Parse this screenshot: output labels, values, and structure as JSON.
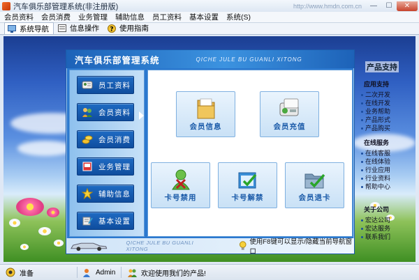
{
  "window": {
    "title": "汽车俱乐部管理系统(非注册版)",
    "url_hint": "http://www.hmdn.com.cn"
  },
  "menu": [
    "会员资料",
    "会员消费",
    "业务管理",
    "辅助信息",
    "员工资料",
    "基本设置",
    "系统(S)"
  ],
  "tabs": [
    {
      "label": "系统导航",
      "icon": "monitor-icon",
      "active": true
    },
    {
      "label": "信息操作",
      "icon": "form-icon",
      "active": false
    },
    {
      "label": "使用指南",
      "icon": "help-icon",
      "active": false
    }
  ],
  "dialog": {
    "title": "汽车俱乐部管理系统",
    "title_en": "QICHE JULE BU GUANLI XITONG",
    "sidebar": [
      {
        "label": "员工资料",
        "icon": "id-card-icon"
      },
      {
        "label": "会员资料",
        "icon": "members-icon"
      },
      {
        "label": "会员消费",
        "icon": "coins-icon"
      },
      {
        "label": "业务管理",
        "icon": "business-icon"
      },
      {
        "label": "辅助信息",
        "icon": "star-icon"
      },
      {
        "label": "基本设置",
        "icon": "settings-icon"
      }
    ],
    "cards": [
      {
        "label": "会员信息",
        "icon": "folder-icon"
      },
      {
        "label": "会员充值",
        "icon": "card-reader-icon"
      },
      {
        "label": "卡号禁用",
        "icon": "user-disable-icon"
      },
      {
        "label": "卡号解禁",
        "icon": "calendar-check-icon"
      },
      {
        "label": "会员退卡",
        "icon": "folder-check-icon"
      }
    ],
    "footer_en": "QICHE JULE BU GUANLI XITONG",
    "footer_tip": "使用F8键可以显示/隐藏当前导航窗口"
  },
  "support": {
    "heading": "产品支持",
    "sections": [
      {
        "title": "应用支持",
        "items": [
          "二次开发",
          "在线开发",
          "业务帮助",
          "产品形式",
          "产品购买"
        ]
      },
      {
        "title": "在线服务",
        "items": [
          "在线客服",
          "在线体验",
          "行业应用",
          "行业资料",
          "帮助中心"
        ]
      },
      {
        "title": "关于公司",
        "items": [
          "宏达公司",
          "宏达服务",
          "联系我们"
        ]
      }
    ]
  },
  "status": {
    "state": "准备",
    "user": "Admin",
    "welcome": "欢迎使用我们的产品!"
  },
  "colors": {
    "accent": "#2b78cf",
    "button": "#1a5fb4",
    "card_text": "#1a5aa8"
  }
}
